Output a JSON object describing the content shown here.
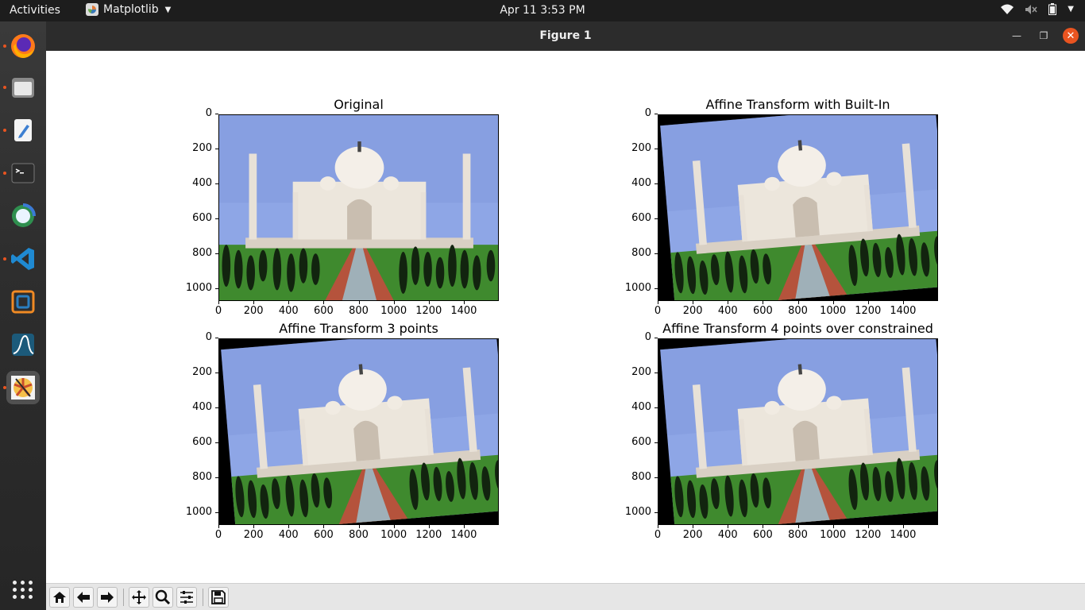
{
  "topbar": {
    "activities": "Activities",
    "app_name": "Matplotlib",
    "clock": "Apr 11   3:53 PM"
  },
  "window": {
    "title": "Figure 1"
  },
  "dock": {
    "items": [
      "firefox-icon",
      "files-icon",
      "text-editor-icon",
      "terminal-icon",
      "network-globe-icon",
      "vscode-icon",
      "virtualbox-icon",
      "matlab-icon",
      "image-app-icon"
    ],
    "active_index": 8
  },
  "figure": {
    "subplots": [
      {
        "title": "Original",
        "yticks": [
          "0",
          "200",
          "400",
          "600",
          "800",
          "1000"
        ],
        "xticks": [
          "0",
          "200",
          "400",
          "600",
          "800",
          "1000",
          "1200",
          "1400"
        ],
        "skew": "none"
      },
      {
        "title": "Affine Transform with Built-In",
        "yticks": [
          "0",
          "200",
          "400",
          "600",
          "800",
          "1000"
        ],
        "xticks": [
          "0",
          "200",
          "400",
          "600",
          "800",
          "1000",
          "1200",
          "1400"
        ],
        "skew": "affine"
      },
      {
        "title": "Affine Transform 3 points",
        "yticks": [
          "0",
          "200",
          "400",
          "600",
          "800",
          "1000"
        ],
        "xticks": [
          "0",
          "200",
          "400",
          "600",
          "800",
          "1000",
          "1200",
          "1400"
        ],
        "skew": "affine"
      },
      {
        "title": "Affine Transform 4 points over constrained",
        "yticks": [
          "0",
          "200",
          "400",
          "600",
          "800",
          "1000"
        ],
        "xticks": [
          "0",
          "200",
          "400",
          "600",
          "800",
          "1000",
          "1200",
          "1400"
        ],
        "skew": "affine"
      }
    ]
  },
  "toolbar": {
    "buttons": [
      "home-icon",
      "back-icon",
      "forward-icon",
      "pan-icon",
      "zoom-icon",
      "configure-subplots-icon",
      "save-icon"
    ]
  },
  "colors": {
    "sky": "#8ea6e6",
    "marble": "#ece6dc",
    "grass": "#3f8a2e",
    "tree": "#12240f",
    "path": "#b5533c",
    "accent": "#e95420"
  }
}
